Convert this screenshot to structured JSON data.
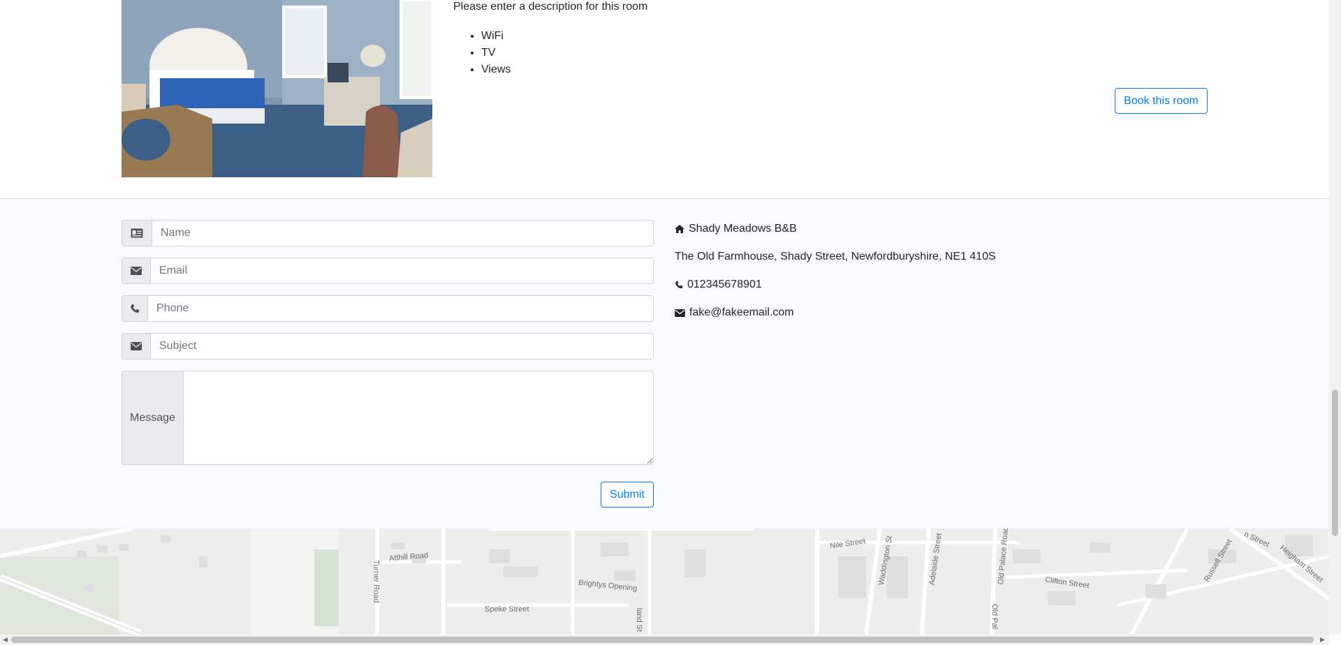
{
  "room": {
    "description": "Please enter a description for this room",
    "amenities": [
      "WiFi",
      "TV",
      "Views"
    ],
    "book_label": "Book this room"
  },
  "contact_form": {
    "name_placeholder": "Name",
    "email_placeholder": "Email",
    "phone_placeholder": "Phone",
    "subject_placeholder": "Subject",
    "message_label": "Message",
    "submit_label": "Submit"
  },
  "contact_info": {
    "business_name": "Shady Meadows B&B",
    "address": "The Old Farmhouse, Shady Street, Newfordburyshire, NE1 410S",
    "phone": "012345678901",
    "email": "fake@fakeemail.com"
  },
  "map": {
    "street_labels": [
      "Atthill Road",
      "Brightys Opening",
      "Speke Street",
      "Nile Street",
      "Waddington St",
      "Adelaide Street",
      "Old Palace Road",
      "Clifton Street",
      "Russell Street",
      "Heigham Street",
      "Turner Road",
      "Old Pal",
      "land St",
      "n Street"
    ]
  },
  "icons": {
    "home": "home-icon",
    "phone": "phone-icon",
    "envelope": "envelope-icon",
    "id_card": "id-card-icon"
  }
}
